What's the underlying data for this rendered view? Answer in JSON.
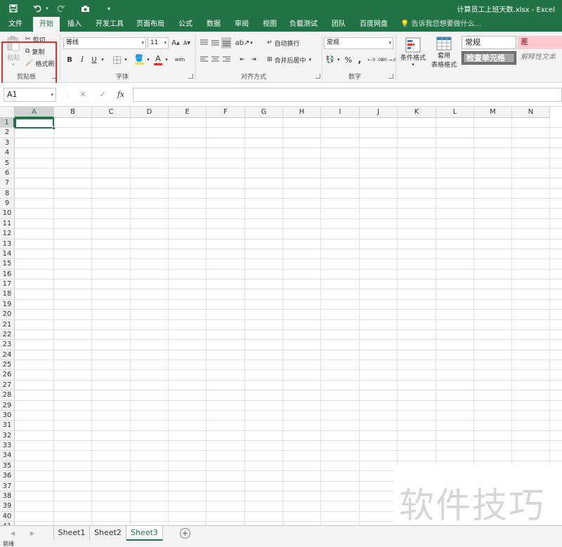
{
  "title_bar": {
    "document_title": "计算员工上班天数.xlsx - Excel",
    "quick_access": [
      {
        "icon": "save-icon"
      },
      {
        "icon": "undo-icon"
      },
      {
        "icon": "redo-icon"
      },
      {
        "icon": "camera-icon"
      },
      {
        "icon": "customize-qat-icon"
      }
    ]
  },
  "ribbon_tabs": {
    "items": [
      "文件",
      "开始",
      "插入",
      "开发工具",
      "页面布局",
      "公式",
      "数据",
      "审阅",
      "视图",
      "负载测试",
      "团队",
      "百度网盘"
    ],
    "active": "开始",
    "tell_me": "告诉我您想要做什么..."
  },
  "ribbon": {
    "clipboard": {
      "label": "剪贴板",
      "paste": "粘贴",
      "cut": "剪切",
      "copy": "复制",
      "format_painter": "格式刷"
    },
    "font": {
      "label": "字体",
      "font_name": "等线",
      "font_size": "11",
      "bold": "B",
      "italic": "I",
      "underline": "U",
      "grow": "A",
      "shrink": "A",
      "font_color_letter": "A",
      "phonetic": "wén",
      "fill_color": "#f6e21a",
      "font_color": "#e0302a"
    },
    "alignment": {
      "label": "对齐方式",
      "wrap_text": "自动换行",
      "merge_center": "合并后居中"
    },
    "number": {
      "label": "数字",
      "format": "常规",
      "percent": "%",
      "comma": ",",
      "increase_decimal": "←.0 .00",
      "decrease_decimal": ".00 →.0"
    },
    "styles": {
      "conditional_formatting": "条件格式",
      "format_as_table_line1": "套用",
      "format_as_table_line2": "表格格式",
      "cell_styles": {
        "normal": "常规",
        "bad": "差",
        "check_cell": "检查单元格",
        "explanatory": "解释性文本"
      }
    }
  },
  "formula_bar": {
    "name_box": "A1",
    "cancel": "✕",
    "enter": "✓",
    "fx": "fx",
    "formula": ""
  },
  "grid": {
    "columns": [
      "A",
      "B",
      "C",
      "D",
      "E",
      "F",
      "G",
      "H",
      "I",
      "J",
      "K",
      "L",
      "M",
      "N"
    ],
    "rows": [
      "1",
      "2",
      "3",
      "4",
      "5",
      "6",
      "7",
      "8",
      "9",
      "10",
      "11",
      "12",
      "13",
      "14",
      "15",
      "16",
      "17",
      "18",
      "19",
      "20",
      "21",
      "22",
      "23",
      "24",
      "25",
      "26",
      "27",
      "28",
      "29",
      "30",
      "31",
      "32",
      "33",
      "34",
      "35",
      "36",
      "37",
      "38",
      "39",
      "40",
      "41"
    ],
    "active_cell": "A1"
  },
  "sheets": {
    "items": [
      "Sheet1",
      "Sheet2",
      "Sheet3"
    ],
    "active": "Sheet3",
    "add": "+"
  },
  "status_bar": {
    "status": "就绪"
  },
  "watermark": "软件技巧",
  "colors": {
    "brand_green": "#217346",
    "highlight_red": "#e0302a",
    "bad_style_fill": "#ffc7ce",
    "bad_style_text": "#9c0006",
    "check_cell_fill": "#a5a5a5"
  }
}
